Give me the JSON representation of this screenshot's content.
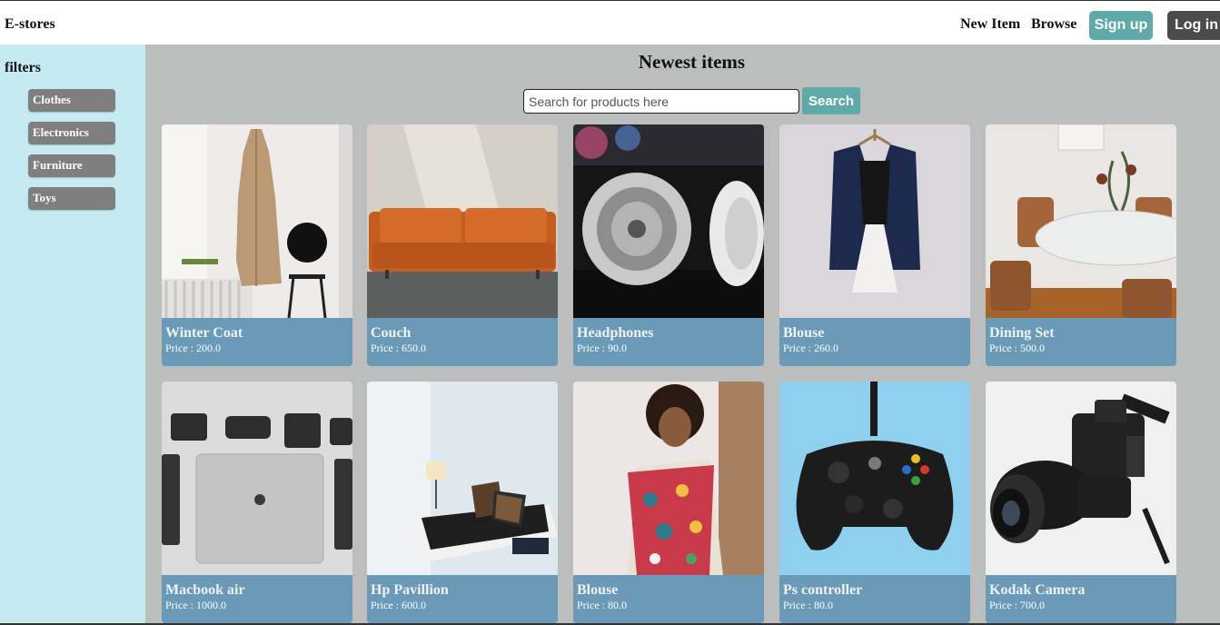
{
  "header": {
    "brand": "E-stores",
    "nav": [
      "New Item",
      "Browse"
    ],
    "signup_label": "Sign up",
    "login_label": "Log in"
  },
  "sidebar": {
    "title": "filters",
    "filters": [
      "Clothes",
      "Electronics",
      "Furniture",
      "Toys"
    ]
  },
  "main": {
    "title": "Newest items",
    "search": {
      "placeholder": "Search for products here",
      "value": "",
      "button_label": "Search"
    },
    "items": [
      {
        "name": "Winter Coat",
        "price": "Price : 200.0",
        "image": "coat-photo"
      },
      {
        "name": "Couch",
        "price": "Price : 650.0",
        "image": "couch-photo"
      },
      {
        "name": "Headphones",
        "price": "Price : 90.0",
        "image": "headphones-photo"
      },
      {
        "name": "Blouse",
        "price": "Price : 260.0",
        "image": "blouse-vest-photo"
      },
      {
        "name": "Dining Set",
        "price": "Price : 500.0",
        "image": "dining-set-photo"
      },
      {
        "name": "Macbook air",
        "price": "Price : 1000.0",
        "image": "macbook-photo"
      },
      {
        "name": "Hp Pavillion",
        "price": "Price : 600.0",
        "image": "desk-laptop-photo"
      },
      {
        "name": "Blouse",
        "price": "Price : 80.0",
        "image": "floral-blouse-photo"
      },
      {
        "name": "Ps controller",
        "price": "Price : 80.0",
        "image": "controller-photo"
      },
      {
        "name": "Kodak Camera",
        "price": "Price : 700.0",
        "image": "camera-photo"
      }
    ]
  },
  "colors": {
    "sidebar_bg": "#c5eaf2",
    "main_bg": "#bcbebe",
    "accent": "#5fa9a8",
    "login_bg": "#4b4b4b",
    "card_caption_bg": "#6b9ab8",
    "filter_bg": "#7f7f7f"
  }
}
